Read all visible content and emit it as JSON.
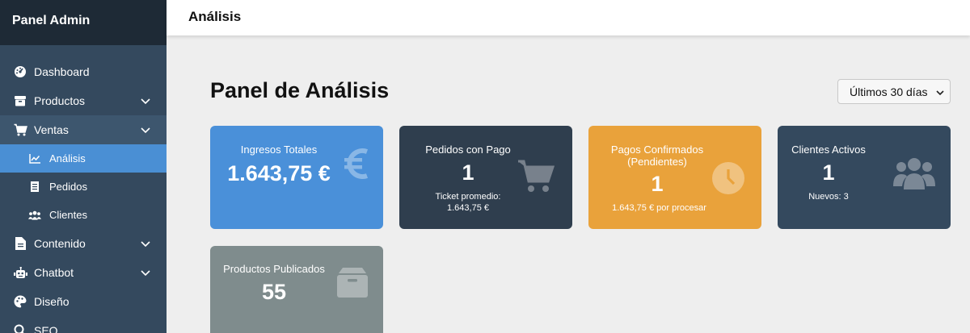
{
  "sidebar": {
    "brand": "Panel Admin",
    "items": [
      {
        "label": "Dashboard",
        "icon": "palette-dashboard-icon"
      },
      {
        "label": "Productos",
        "icon": "box-icon",
        "expandable": true
      },
      {
        "label": "Ventas",
        "icon": "cart-icon",
        "expandable": true,
        "open": true
      },
      {
        "label": "Contenido",
        "icon": "document-icon",
        "expandable": true
      },
      {
        "label": "Chatbot",
        "icon": "robot-icon",
        "expandable": true
      },
      {
        "label": "Diseño",
        "icon": "palette-icon"
      },
      {
        "label": "SEO",
        "icon": "search-icon"
      }
    ],
    "sub_items": [
      {
        "label": "Análisis",
        "icon": "chart-line-icon",
        "active": true
      },
      {
        "label": "Pedidos",
        "icon": "receipt-icon"
      },
      {
        "label": "Clientes",
        "icon": "users-icon"
      }
    ]
  },
  "topbar": {
    "title": "Análisis"
  },
  "main": {
    "page_title": "Panel de Análisis",
    "range_select": {
      "value": "Últimos 30 días"
    }
  },
  "cards": {
    "revenue": {
      "title": "Ingresos Totales",
      "value": "1.643,75 €",
      "icon": "euro-icon",
      "color": "#4a90d9"
    },
    "orders": {
      "title": "Pedidos con Pago",
      "value": "1",
      "sub_line1": "Ticket promedio:",
      "sub_line2": "1.643,75 €",
      "icon": "cart-icon",
      "color": "#2f3e4e"
    },
    "payments": {
      "title_line1": "Pagos Confirmados",
      "title_line2": "(Pendientes)",
      "value": "1",
      "sub": "1.643,75 € por procesar",
      "icon": "clock-icon",
      "color": "#e9a23b"
    },
    "customers": {
      "title": "Clientes Activos",
      "value": "1",
      "sub": "Nuevos: 3",
      "icon": "users-icon",
      "color": "#34495e"
    },
    "products": {
      "title": "Productos Publicados",
      "value": "55",
      "icon": "box-icon",
      "color": "#7f8c8d"
    }
  }
}
